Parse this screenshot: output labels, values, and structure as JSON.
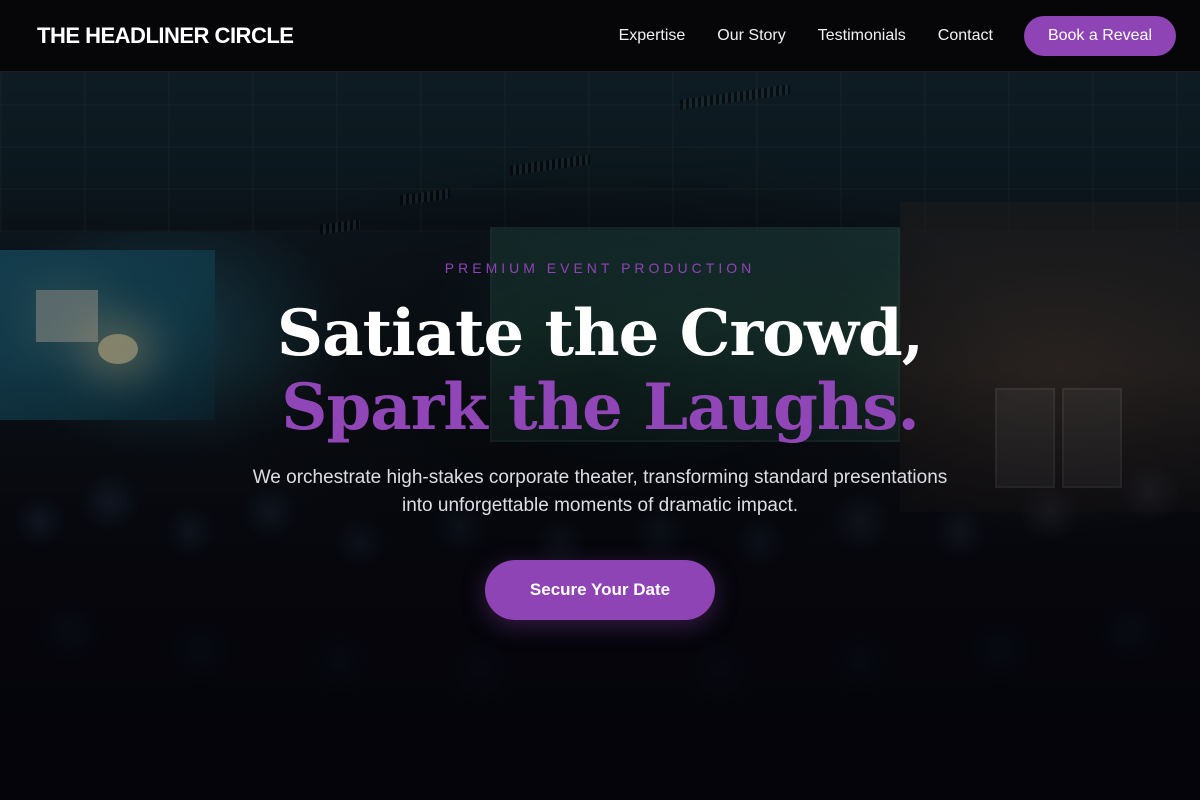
{
  "brand": {
    "name": "THE HEADLINER CIRCLE"
  },
  "nav": {
    "links": [
      {
        "label": "Expertise"
      },
      {
        "label": "Our Story"
      },
      {
        "label": "Testimonials"
      },
      {
        "label": "Contact"
      }
    ],
    "cta_label": "Book a Reveal"
  },
  "hero": {
    "eyebrow": "PREMIUM EVENT PRODUCTION",
    "headline_line1": "Satiate the Crowd,",
    "headline_line2": "Spark the Laughs.",
    "subtitle": "We orchestrate high-stakes corporate theater, transforming standard presentations into unforgettable moments of dramatic impact.",
    "cta_label": "Secure Your Date",
    "background_image": "conference-audience-photo"
  },
  "colors": {
    "accent": "#8e44b4",
    "navbar_bg": "#06060a",
    "text_primary": "#ffffff",
    "text_secondary": "#dedde4"
  }
}
